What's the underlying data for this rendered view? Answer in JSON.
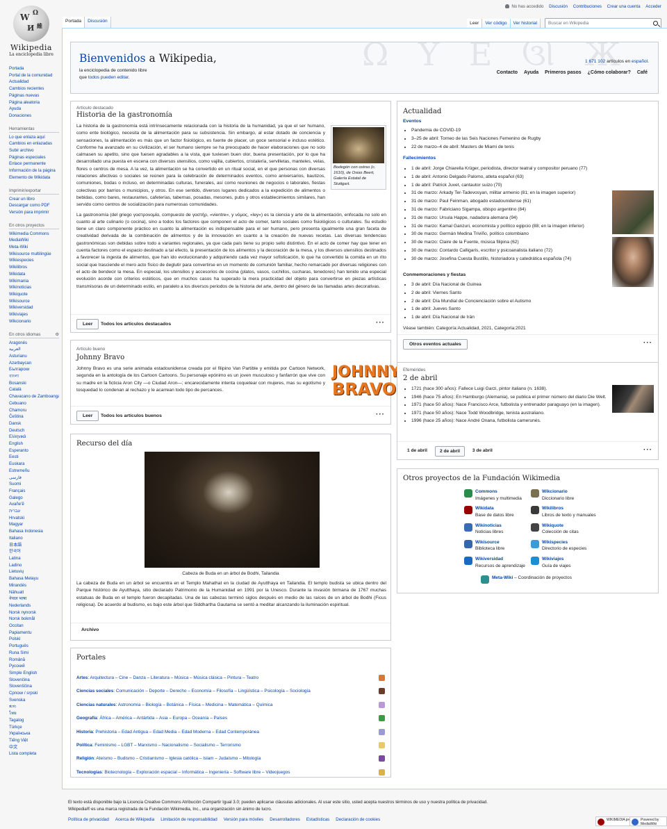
{
  "logo": {
    "wordmark": "Wikipedia",
    "tagline": "La enciclopedia libre"
  },
  "personal": [
    "No has accedido",
    "Discusión",
    "Contribuciones",
    "Crear una cuenta",
    "Acceder"
  ],
  "tabs_left": [
    "Portada",
    "Discusión"
  ],
  "tabs_right": [
    "Leer",
    "Ver código",
    "Ver historial"
  ],
  "search": {
    "placeholder": "Buscar en Wikipedia"
  },
  "sidebar": {
    "main": [
      "Portada",
      "Portal de la comunidad",
      "Actualidad",
      "Cambios recientes",
      "Páginas nuevas",
      "Página aleatoria",
      "Ayuda",
      "Donaciones"
    ],
    "tools_head": "Herramientas",
    "tools": [
      "Lo que enlaza aquí",
      "Cambios en enlazadas",
      "Subir archivo",
      "Páginas especiales",
      "Enlace permanente",
      "Información de la página",
      "Elemento de Wikidata"
    ],
    "print_head": "Imprimir/exportar",
    "print": [
      "Crear un libro",
      "Descargar como PDF",
      "Versión para imprimir"
    ],
    "projects_head": "En otros proyectos",
    "projects": [
      "Wikimedia Commons",
      "MediaWiki",
      "Meta-Wiki",
      "Wikisource multilingüe",
      "Wikiespecies",
      "Wikilibros",
      "Wikidata",
      "Wikimania",
      "Wikinoticias",
      "Wikiquote",
      "Wikisource",
      "Wikiversidad",
      "Wikiviajes",
      "Wikcionario"
    ],
    "langs_head": "En otros idiomas",
    "langs": [
      "Aragonés",
      "العربية",
      "Asturianu",
      "Azərbaycan",
      "Български",
      "বাংলা",
      "Bosanski",
      "Català",
      "Chavacano de Zamboanga",
      "Cebuano",
      "Chamoru",
      "Čeština",
      "Dansk",
      "Deutsch",
      "Ελληνικά",
      "English",
      "Esperanto",
      "Eesti",
      "Euskara",
      "Estremeñu",
      "فارسی",
      "Suomi",
      "Français",
      "Galego",
      "Avañe'ẽ",
      "עברית",
      "Hrvatski",
      "Magyar",
      "Bahasa Indonesia",
      "Italiano",
      "日本語",
      "한국어",
      "Latina",
      "Ladino",
      "Lietuvių",
      "Bahasa Melayu",
      "Mirandés",
      "Nāhuatl",
      "नेपाल भाषा",
      "Nederlands",
      "Norsk nynorsk",
      "Norsk bokmål",
      "Occitan",
      "Papiamentu",
      "Polski",
      "Português",
      "Runa Simi",
      "Română",
      "Русский",
      "Simple English",
      "Slovenčina",
      "Slovenščina",
      "Српски / srpski",
      "Svenska",
      "ತುಳು",
      "ไทย",
      "Tagalog",
      "Türkçe",
      "Українська",
      "Tiếng Việt",
      "中文",
      "Lista completa"
    ]
  },
  "welcome": {
    "title_a": "Bienvenidos",
    "title_b": " a Wikipedia,",
    "sub1": "la enciclopedia de contenido libre",
    "sub2a": "que ",
    "sub2b": "todos pueden editar",
    "sub2c": ".",
    "count_num": "1 671 102",
    "count_text": " artículos en ",
    "count_lang": "español",
    "count_end": ".",
    "nav": [
      "Contacto",
      "Ayuda",
      "Primeros pasos",
      "¿Cómo colaborar?",
      "Café"
    ]
  },
  "featured": {
    "kicker": "Artículo destacado",
    "title": "Historia de la gastronomía",
    "thumb_caption": "Bodegón con ostras (c. 1610), de Osias Beert, Galería Estatal de Stuttgart.",
    "p1": "La historia de la gastronomía está intrínsecamente relacionada con la historia de la humanidad, ya que el ser humano, como ente biológico, necesita de la alimentación para su subsistencia. Sin embargo, al estar dotado de conciencia y sensaciones, la alimentación es más que un factor fisiológico, es fuente de placer, un goce sensorial e incluso estético. Conforme ha avanzado en su civilización, el ser humano siempre se ha preocupado de hacer elaboraciones que no solo calmasen su apetito, sino que fuesen agradables a la vista, que tuviesen buen olor, buena presentación, por lo que ha desarrollado una puesta en escena con diversos utensilios, como vajilla, cubiertos, cristalería, servilletas, manteles, velas, flores o centros de mesa. A la vez, la alimentación se ha convertido en un ritual social, en el que personas con diversas relaciones afectivas o sociales se reúnen para la celebración de determinados eventos, como aniversarios, bautizos, comuniones, bodas o incluso, en determinadas culturas, funerales, así como reuniones de negocios o laborales, fiestas colectivas por barrios o municipios, y otros. En ese sentido, diversos lugares dedicados a la expedición de alimentos o bebidas, como bares, restaurantes, cafeterías, tabernas, posadas, mesones, pubs y otros establecimientos similares, han servido como centros de socialización para numerosas comunidades.",
    "p2": "La gastronomía (del griego γαστρονομία, compuesto de γαστήρ, «vientre», y νόμος, «ley») es la ciencia y arte de la alimentación, enfocada no solo en cuanto al arte culinario (o cocina), sino a todos los factores que componen el acto de comer, tanto sociales como fisiológicos o culturales. Su estudio tiene un claro componente práctico en cuanto la alimentación es indispensable para el ser humano, pero presenta igualmente una gran faceta de creatividad derivada de la combinación de alimentos y de la innovación en cuanto a la creación de nuevas recetas. Las diversas tendencias gastronómicas son debidas sobre todo a variantes regionales, ya que cada país tiene su propio sello distintivo. En el acto de comer hay que tener en cuenta factores como el espacio destinado a tal efecto, la presentación de los alimentos y la decoración de la mesa, y los diversos utensilios destinados a favorecer la ingesta de alimentos, que han ido evolucionando y adquiriendo cada vez mayor sofisticación, lo que ha convertido la comida en un rito social que trasciende el mero acto físico de deglutir para convertirse en un momento de comunión familiar, hecho remarcado por diversas religiones con el acto de bendecir la mesa. En especial, los utensilios y accesorios de cocina (platos, vasos, cuchillos, cucharas, tenedores) han tenido una especial evolución acorde con criterios estéticos, que en muchos casos ha superado la mera practicidad del objeto para convertirse en piezas artísticas transmisoras de un determinado estilo, en paralelo a los diversos periodos de la historia del arte, dentro del género de las llamadas artes decorativas.",
    "read": "Leer",
    "all": "Todos los artículos destacados"
  },
  "good": {
    "kicker": "Artículo bueno",
    "title": "Johnny Bravo",
    "p": "Johnny Bravo es una serie animada estadounidense creada por el filipino Van Partible y emitida por Cartoon Network, segunda en la antología de los Cartoon Cartoons. Su personaje epónimo es un joven musculoso y fanfarrón que vive con su madre en la ficticia Aron City —o Ciudad Aron—; encarecidamente intenta coquetear con mujeres, mas su egotismo y tosquedad lo condenan al rechazo y le acarrean todo tipo de percances.",
    "logo1": "JOHNNY",
    "logo2": "BRAVO",
    "read": "Leer",
    "all": "Todos los artículos buenos"
  },
  "resource": {
    "title": "Recurso del día",
    "caption": "Cabeza de Buda en un árbol de Bodhi, Tailandia",
    "p": "La cabeza de Buda en un árbol se encuentra en el Templo Mahathat en la ciudad de Ayutthaya en Tailandia. El templo budista se ubica dentro del Parque histórico de Ayutthaya, sitio declarado Patrimonio de la Humanidad en 1991 por la Unesco. Durante la invasión birmana de 1767 muchas estatuas de Buda en el templo fueron decapitadas. Una de las cabezas terminó siglos después en medio de las raíces de un árbol de Bodhi (Ficus religiosa). De acuerdo al budismo, es bajo este árbol que Siddhartha Gautama se sentó a meditar alcanzando la iluminación espiritual.",
    "archive": "Archivo"
  },
  "portals": {
    "title": "Portales",
    "rows": [
      {
        "name": "Artes",
        "items": "Arquitectura – Cine – Danza – Literatura – Música – Música clásica – Pintura – Teatro"
      },
      {
        "name": "Ciencias sociales",
        "items": "Comunicación – Deporte – Derecho – Economía – Filosofía – Lingüística – Psicología – Sociología"
      },
      {
        "name": "Ciencias naturales",
        "items": "Astronomía – Biología – Botánica – Física – Medicina – Matemática – Química"
      },
      {
        "name": "Geografía",
        "items": "África – América – Antártida – Asia – Europa – Oceanía – Países"
      },
      {
        "name": "Historia",
        "items": "Prehistoria – Edad Antigua – Edad Media – Edad Moderna – Edad Contemporánea"
      },
      {
        "name": "Política",
        "items": "Feminismo – LGBT – Marxismo – Nacionalismo – Socialismo – Terrorismo"
      },
      {
        "name": "Religión",
        "items": "Ateísmo – Budismo – Cristianismo – Iglesia católica – Islam – Judaísmo – Mitología"
      },
      {
        "name": "Tecnologías",
        "items": "Biotecnología – Exploración espacial – Informática – Ingeniería – Software libre – Videojuegos"
      }
    ]
  },
  "news": {
    "title": "Actualidad",
    "events_head": "Eventos",
    "events": [
      "Pandemia de COVID-19",
      "3–25 de abril: Torneo de las Seis Naciones Femenino de Rugby",
      "22 de marzo–4 de abril: Masters de Miami de tenis"
    ],
    "deaths_head": "Fallecimientos",
    "deaths": [
      "1 de abril: Jorge Chiarella Krüger, periodista, director teatral y compositor peruano (77)",
      "1 de abril: Antonio Delgado Palomo, atleta español (63)",
      "1 de abril: Patrick Juvet, cantautor suizo (70)",
      "31 de marzo: Arkady Ter-Tadevosyan, militar armenio (81; en la imagen superior)",
      "31 de marzo: Paul Feinman, abogado estadounidense (61)",
      "31 de marzo: Fabriciano Sigampa, obispo argentino (84)",
      "31 de marzo: Ursula Happe, nadadora alemana (94)",
      "31 de marzo: Kamal Ganzuri, economista y político egipcio (88; en la imagen inferior)",
      "30 de marzo: Germán Medina Triviño, político colombiano",
      "30 de marzo: Claire de la Fuente, música filipina (62)",
      "30 de marzo: Contardo Calligaris, escritor y psicoanalista italiano (72)",
      "30 de marzo: Josefina Cuesta Bustillo, historiadora y catedrática española (74)"
    ],
    "comm_head": "Conmemoraciones y fiestas",
    "comm": [
      "3 de abril: Día Nacional de Guinea",
      "2 de abril: Viernes Santo",
      "2 de abril: Día Mundial de Concienciación sobre el Autismo",
      "1 de abril: Jueves Santo",
      "1 de abril: Día Nacional de Irán"
    ],
    "see_also": "Véase también: Categoría:Actualidad, 2021, Categoría:2021",
    "more": "Otros eventos actuales"
  },
  "ephem": {
    "kicker": "Efemérides",
    "title": "2 de abril",
    "items": [
      "1721 (hace 300 años): Fallece Luigi Garzi, pintor italiano (n. 1638).",
      "1946 (hace 75 años): En Hamburgo (Alemania), se publica el primer número del diario Die Welt.",
      "1971 (hace 50 años): Nace Francisco Arce, futbolista y entrenador paraguayo (en la imagen).",
      "1971 (hace 50 años): Nace Todd Woodbridge, tenista australiano.",
      "1996 (hace 25 años): Nace André Onana, futbolista camerunés."
    ],
    "days": [
      "1 de abril",
      "2 de abril",
      "3 de abril"
    ]
  },
  "projects": {
    "title": "Otros proyectos de la Fundación Wikimedia",
    "items": [
      {
        "name": "Commons",
        "desc": "Imágenes y multimedia",
        "color": "#2a8c4a"
      },
      {
        "name": "Wikcionario",
        "desc": "Diccionario libre",
        "color": "#7a6f4e"
      },
      {
        "name": "Wikidata",
        "desc": "Base de datos libre",
        "color": "#990000"
      },
      {
        "name": "Wikilibros",
        "desc": "Libros de texto y manuales",
        "color": "#3a3a3a"
      },
      {
        "name": "Wikinoticias",
        "desc": "Noticias libres",
        "color": "#3a6cb5"
      },
      {
        "name": "Wikiquote",
        "desc": "Colección de citas",
        "color": "#444444"
      },
      {
        "name": "Wikisource",
        "desc": "Biblioteca libre",
        "color": "#3366aa"
      },
      {
        "name": "Wikispecies",
        "desc": "Directorio de especies",
        "color": "#3a9bd6"
      },
      {
        "name": "Wikiversidad",
        "desc": "Recursos de aprendizaje",
        "color": "#1a6ac0"
      },
      {
        "name": "Wikiviajes",
        "desc": "Guía de viajes",
        "color": "#1d8ed1"
      }
    ],
    "meta_name": "Meta-Wiki",
    "meta_desc": " – Coordinación de proyectos",
    "meta_color": "#2f8f8f"
  },
  "footer": {
    "line1": "El texto está disponible bajo la Licencia Creative Commons Atribución Compartir Igual 3.0; pueden aplicarse cláusulas adicionales. Al usar este sitio, usted acepta nuestros términos de uso y nuestra política de privacidad.",
    "line2": "Wikipedia® es una marca registrada de la Fundación Wikimedia, Inc., una organización sin ánimo de lucro.",
    "links": [
      "Política de privacidad",
      "Acerca de Wikipedia",
      "Limitación de responsabilidad",
      "Versión para móviles",
      "Desarrolladores",
      "Estadísticas",
      "Declaración de cookies"
    ],
    "badge1": "WIKIMEDIA project",
    "badge2": "Powered by MediaWiki"
  }
}
